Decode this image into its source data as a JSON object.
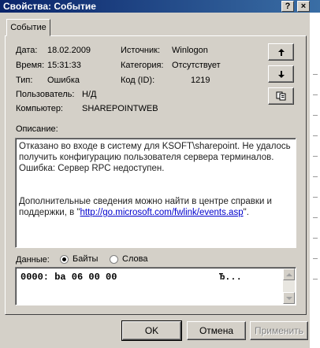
{
  "window": {
    "title": "Свойства: Событие",
    "help_glyph": "?",
    "close_glyph": "×"
  },
  "tabs": [
    {
      "label": "Событие"
    }
  ],
  "fields": {
    "date_label": "Дата:",
    "date_value": "18.02.2009",
    "time_label": "Время:",
    "time_value": "15:31:33",
    "type_label": "Тип:",
    "type_value": "Ошибка",
    "user_label": "Пользователь:",
    "user_value": "Н/Д",
    "computer_label": "Компьютер:",
    "computer_value": "SHAREPOINTWEB",
    "source_label": "Источник:",
    "source_value": "Winlogon",
    "category_label": "Категория:",
    "category_value": "Отсутствует",
    "event_id_label": "Код (ID):",
    "event_id_value": "1219"
  },
  "description": {
    "label": "Описание:",
    "line1": "Отказано во входе в систему для KSOFT\\sharepoint. Не удалось получить конфигурацию пользователя сервера терминалов. Ошибка: Сервер RPC недоступен.",
    "line2_prefix": "Дополнительные сведения можно найти в центре справки и поддержки, в \"",
    "link": "http://go.microsoft.com/fwlink/events.asp",
    "line2_suffix": "\"."
  },
  "data_section": {
    "label": "Данные:",
    "options": [
      {
        "label": "Байты",
        "selected": true
      },
      {
        "label": "Слова",
        "selected": false
      }
    ],
    "hex_line": "0000: ba 06 00 00",
    "ascii": "Ђ..."
  },
  "buttons": {
    "ok": "OK",
    "cancel": "Отмена",
    "apply": "Применить"
  },
  "icons": {
    "prev": "arrow-up-icon",
    "next": "arrow-down-icon",
    "copy": "copy-icon"
  }
}
